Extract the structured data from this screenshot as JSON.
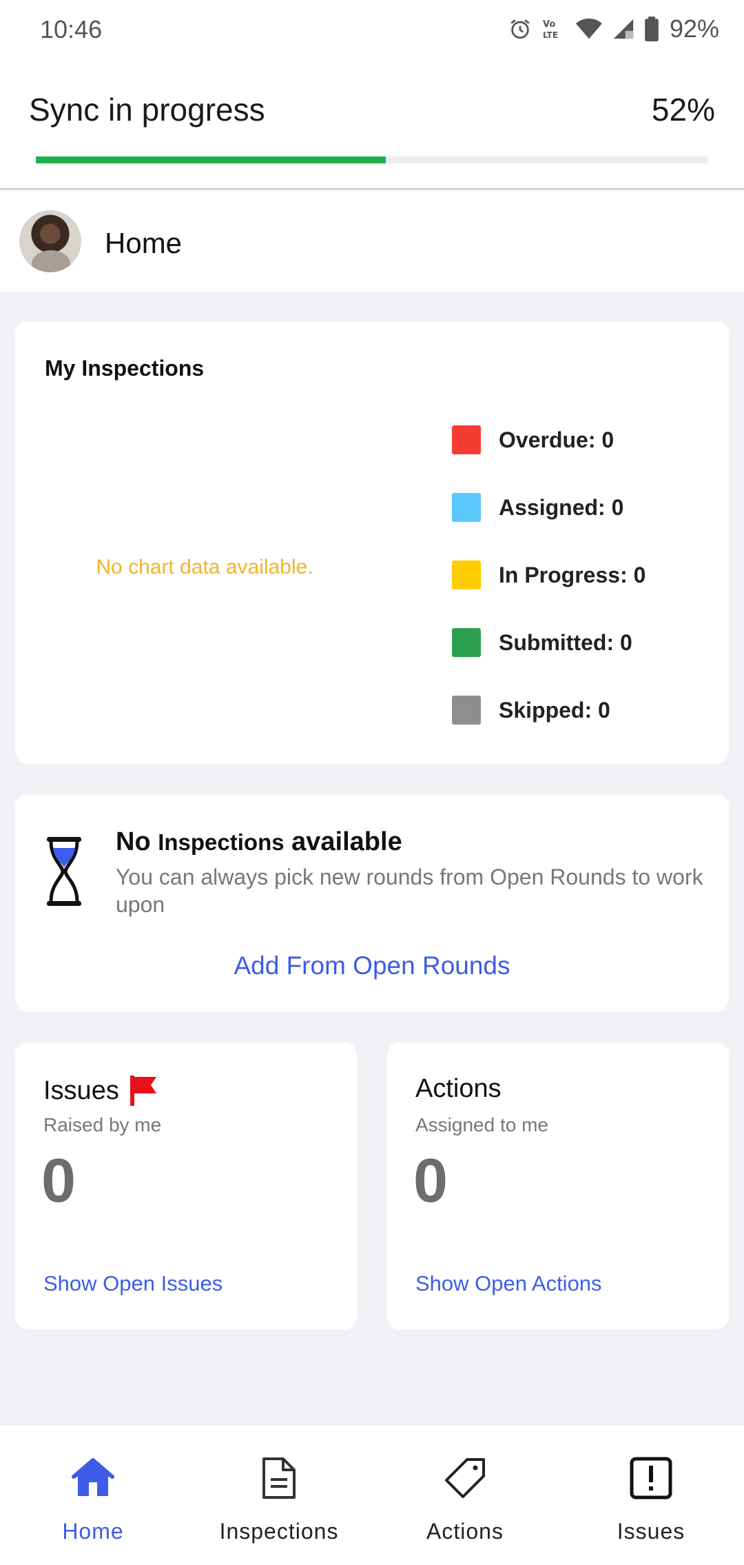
{
  "status_bar": {
    "time": "10:46",
    "battery": "92%",
    "icons": [
      "alarm-icon",
      "volte-icon",
      "wifi-icon",
      "signal-icon",
      "battery-icon"
    ]
  },
  "sync": {
    "title": "Sync in progress",
    "percent_label": "52%",
    "progress": 0.52,
    "color": "#1fb24a"
  },
  "header": {
    "title": "Home"
  },
  "inspections_card": {
    "title": "My Inspections",
    "no_data": "No chart data available.",
    "legend": [
      {
        "label": "Overdue: 0",
        "color": "#f43c32"
      },
      {
        "label": "Assigned: 0",
        "color": "#5ac8fa"
      },
      {
        "label": "In Progress: 0",
        "color": "#ffcc00"
      },
      {
        "label": "Submitted: 0",
        "color": "#2ca04f"
      },
      {
        "label": "Skipped: 0",
        "color": "#8e8e8e"
      }
    ]
  },
  "empty_card": {
    "title_a": "No",
    "title_b": "Inspections",
    "title_c": "available",
    "description": "You can always pick new rounds from Open Rounds to work upon",
    "link": "Add From Open Rounds"
  },
  "issues_card": {
    "title": "Issues",
    "subtitle": "Raised by me",
    "count": "0",
    "link": "Show Open Issues"
  },
  "actions_card": {
    "title": "Actions",
    "subtitle": "Assigned to me",
    "count": "0",
    "link": "Show Open Actions"
  },
  "bottom_nav": {
    "items": [
      {
        "label": "Home",
        "icon": "home-icon",
        "active": true
      },
      {
        "label": "Inspections",
        "icon": "document-icon",
        "active": false
      },
      {
        "label": "Actions",
        "icon": "tag-icon",
        "active": false
      },
      {
        "label": "Issues",
        "icon": "alert-square-icon",
        "active": false
      }
    ]
  },
  "colors": {
    "accent": "#3d5ce8",
    "no_data": "#f0b429"
  }
}
